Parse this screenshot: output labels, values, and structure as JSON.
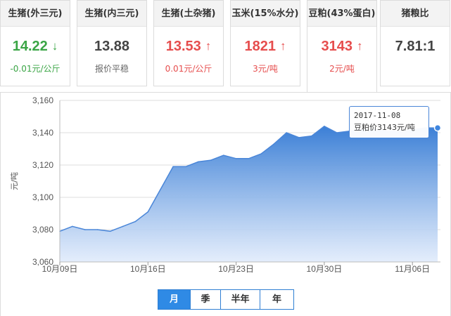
{
  "cards": [
    {
      "title": "生猪(外三元)",
      "value": "14.22",
      "trend": "down",
      "change": "-0.01元/公斤"
    },
    {
      "title": "生猪(内三元)",
      "value": "13.88",
      "trend": "flat",
      "change": "报价平稳"
    },
    {
      "title": "生猪(土杂猪)",
      "value": "13.53",
      "trend": "up",
      "change": "0.01元/公斤"
    },
    {
      "title": "玉米(15%水分)",
      "value": "1821",
      "trend": "up",
      "change": "3元/吨"
    },
    {
      "title": "豆粕(43%蛋白)",
      "value": "3143",
      "trend": "up",
      "change": "2元/吨",
      "active": true
    },
    {
      "title": "猪粮比",
      "value": "7.81:1",
      "trend": "flat",
      "change": ""
    }
  ],
  "icons": {
    "up": "arrow-up-icon",
    "down": "arrow-down-icon"
  },
  "colors": {
    "up": "#e64d4d",
    "down": "#3aa545",
    "accent": "#2f8ae5",
    "line": "#4a86d8"
  },
  "tooltip": {
    "date": "2017-11-08",
    "label": "豆粕价3143元/吨"
  },
  "periods": [
    "月",
    "季",
    "半年",
    "年"
  ],
  "active_period": "月",
  "chart_data": {
    "type": "area",
    "ylabel": "元/吨",
    "ylim": [
      3060,
      3160
    ],
    "yticks": [
      3060,
      3080,
      3100,
      3120,
      3140,
      3160
    ],
    "yticklabels": [
      "3,060",
      "3,080",
      "3,100",
      "3,120",
      "3,140",
      "3,160"
    ],
    "xticks": [
      "10月09日",
      "10月16日",
      "10月23日",
      "10月30日",
      "11月06日"
    ],
    "x": [
      "10-09",
      "10-10",
      "10-11",
      "10-12",
      "10-13",
      "10-14",
      "10-15",
      "10-16",
      "10-17",
      "10-18",
      "10-19",
      "10-20",
      "10-21",
      "10-22",
      "10-23",
      "10-24",
      "10-25",
      "10-26",
      "10-27",
      "10-28",
      "10-29",
      "10-30",
      "10-31",
      "11-01",
      "11-02",
      "11-03",
      "11-04",
      "11-05",
      "11-06",
      "11-07",
      "11-08"
    ],
    "values": [
      3079,
      3082,
      3080,
      3080,
      3079,
      3082,
      3085,
      3091,
      3105,
      3119,
      3119,
      3122,
      3123,
      3126,
      3124,
      3124,
      3127,
      3133,
      3140,
      3137,
      3138,
      3144,
      3140,
      3141,
      3142,
      3142,
      3141,
      3141,
      3142,
      3143,
      3143
    ],
    "grid": true,
    "color": "#4a86d8"
  }
}
